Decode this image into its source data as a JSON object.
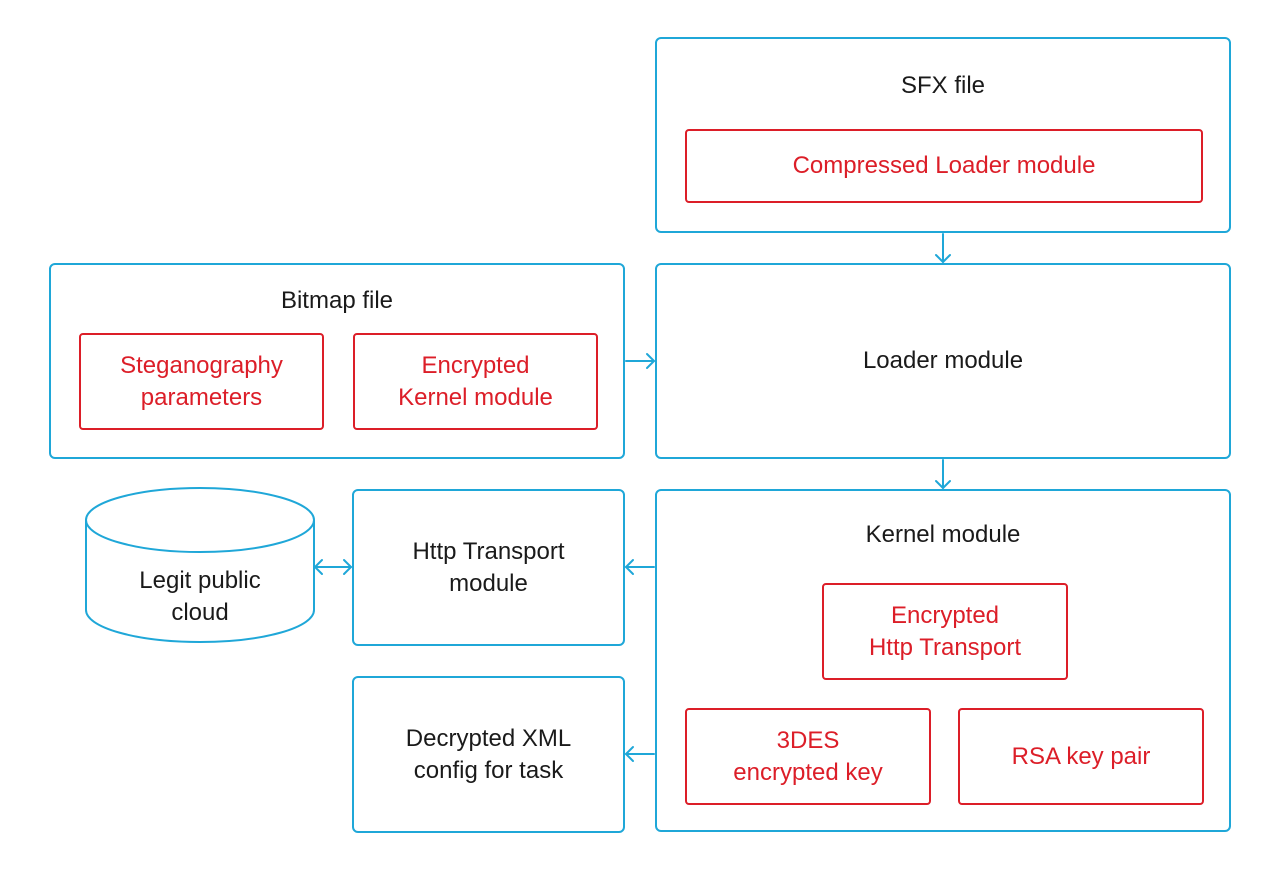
{
  "diagram": {
    "colors": {
      "container_stroke": "#1fa7d8",
      "inner_stroke": "#dc1e28",
      "text": "#1a1a1a",
      "inner_text": "#dc1e28"
    },
    "nodes": {
      "sfx_file": {
        "label": "SFX file",
        "children": {
          "compressed_loader": "Compressed Loader module"
        }
      },
      "bitmap_file": {
        "label": "Bitmap file",
        "children": {
          "steganography": "Steganography\nparameters",
          "encrypted_kernel": "Encrypted\nKernel module"
        }
      },
      "loader_module": {
        "label": "Loader module"
      },
      "kernel_module": {
        "label": "Kernel module",
        "children": {
          "encrypted_http": "Encrypted\nHttp Transport",
          "des_key": "3DES\nencrypted key",
          "rsa_pair": "RSA key pair"
        }
      },
      "http_transport": {
        "label": "Http Transport\nmodule"
      },
      "decrypted_xml": {
        "label": "Decrypted XML\nconfig for task"
      },
      "public_cloud": {
        "label": "Legit public\ncloud",
        "shape": "cylinder"
      }
    },
    "edges": [
      {
        "from": "SFX file",
        "to": "Loader module",
        "direction": "one-way"
      },
      {
        "from": "Bitmap file",
        "to": "Loader module",
        "direction": "one-way"
      },
      {
        "from": "Loader module",
        "to": "Kernel module",
        "direction": "one-way"
      },
      {
        "from": "Kernel module",
        "to": "Http Transport module",
        "direction": "one-way"
      },
      {
        "from": "Kernel module",
        "to": "Decrypted XML config for task",
        "direction": "one-way"
      },
      {
        "from": "Http Transport module",
        "to": "Legit public cloud",
        "direction": "two-way"
      }
    ]
  }
}
